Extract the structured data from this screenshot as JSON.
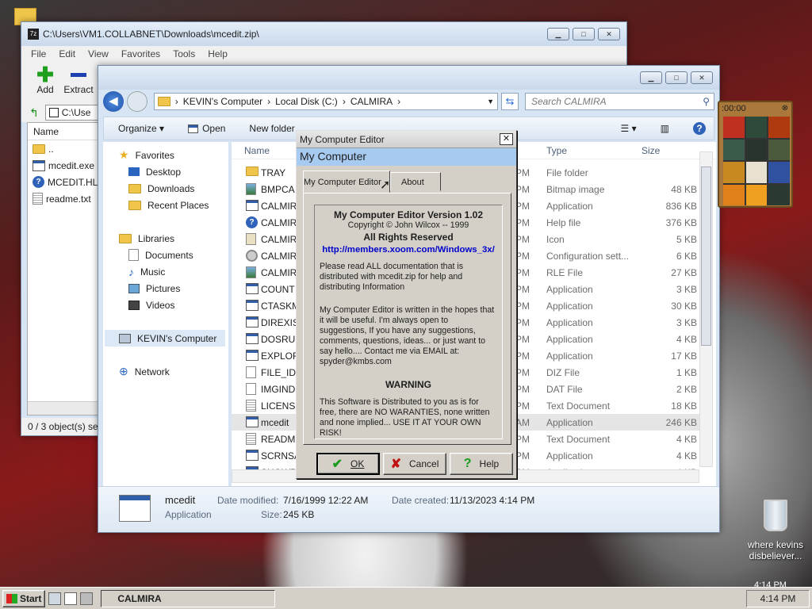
{
  "zip_window": {
    "title": "C:\\Users\\VM1.COLLABNET\\Downloads\\mcedit.zip\\",
    "menu": [
      "File",
      "Edit",
      "View",
      "Favorites",
      "Tools",
      "Help"
    ],
    "toolbar": {
      "add": "Add",
      "extract": "Extract"
    },
    "address": "C:\\Use",
    "col_name": "Name",
    "files": [
      {
        "name": "..",
        "icon": "folder-up"
      },
      {
        "name": "mcedit.exe",
        "icon": "app"
      },
      {
        "name": "MCEDIT.HLP",
        "icon": "help"
      },
      {
        "name": "readme.txt",
        "icon": "text"
      }
    ],
    "status": "0 / 3 object(s) se"
  },
  "explorer": {
    "breadcrumb": [
      "KEVIN's Computer",
      "Local Disk (C:)",
      "CALMIRA"
    ],
    "search_placeholder": "Search CALMIRA",
    "toolbar": {
      "organize": "Organize",
      "open": "Open",
      "new_folder": "New folder"
    },
    "nav": {
      "favorites": "Favorites",
      "fav_items": [
        "Desktop",
        "Downloads",
        "Recent Places"
      ],
      "libraries": "Libraries",
      "lib_items": [
        "Documents",
        "Music",
        "Pictures",
        "Videos"
      ],
      "computer": "KEVIN's Computer",
      "network": "Network"
    },
    "columns": {
      "name": "Name",
      "type": "Type",
      "size": "Size"
    },
    "files": [
      {
        "name": "TRAY",
        "date": "PM",
        "type": "File folder",
        "size": "",
        "icon": "folder"
      },
      {
        "name": "BMPCA",
        "date": "PM",
        "type": "Bitmap image",
        "size": "48 KB",
        "icon": "image"
      },
      {
        "name": "CALMIR",
        "date": "PM",
        "type": "Application",
        "size": "836 KB",
        "icon": "app"
      },
      {
        "name": "CALMIR",
        "date": "PM",
        "type": "Help file",
        "size": "376 KB",
        "icon": "help"
      },
      {
        "name": "CALMIR",
        "date": "PM",
        "type": "Icon",
        "size": "5 KB",
        "icon": "icon"
      },
      {
        "name": "CALMIR",
        "date": "PM",
        "type": "Configuration sett...",
        "size": "6 KB",
        "icon": "config"
      },
      {
        "name": "CALMIR",
        "date": "PM",
        "type": "RLE File",
        "size": "27 KB",
        "icon": "image"
      },
      {
        "name": "COUNT",
        "date": "PM",
        "type": "Application",
        "size": "3 KB",
        "icon": "app"
      },
      {
        "name": "CTASKM",
        "date": "PM",
        "type": "Application",
        "size": "30 KB",
        "icon": "app"
      },
      {
        "name": "DIREXIST",
        "date": "PM",
        "type": "Application",
        "size": "3 KB",
        "icon": "app"
      },
      {
        "name": "DOSRUN",
        "date": "PM",
        "type": "Application",
        "size": "4 KB",
        "icon": "app"
      },
      {
        "name": "EXPLORI",
        "date": "PM",
        "type": "Application",
        "size": "17 KB",
        "icon": "app"
      },
      {
        "name": "FILE_ID.D",
        "date": "PM",
        "type": "DIZ File",
        "size": "1 KB",
        "icon": "file"
      },
      {
        "name": "IMGINDI",
        "date": "PM",
        "type": "DAT File",
        "size": "2 KB",
        "icon": "file"
      },
      {
        "name": "LICENSE",
        "date": "PM",
        "type": "Text Document",
        "size": "18 KB",
        "icon": "text"
      },
      {
        "name": "mcedit",
        "date": "AM",
        "type": "Application",
        "size": "246 KB",
        "icon": "app",
        "selected": true
      },
      {
        "name": "README",
        "date": "PM",
        "type": "Text Document",
        "size": "4 KB",
        "icon": "text"
      },
      {
        "name": "SCRNSA",
        "date": "PM",
        "type": "Application",
        "size": "4 KB",
        "icon": "app"
      },
      {
        "name": "SHOWD",
        "date": "PM",
        "type": "Application",
        "size": "4 KB",
        "icon": "app"
      }
    ],
    "details": {
      "name": "mcedit",
      "type": "Application",
      "modified_label": "Date modified:",
      "modified": "7/16/1999 12:22 AM",
      "created_label": "Date created:",
      "created": "11/13/2023 4:14 PM",
      "size_label": "Size:",
      "size": "245 KB"
    }
  },
  "dialog": {
    "title": "My Computer Editor",
    "header": "My Computer",
    "tabs": [
      "My Computer Editor",
      "About"
    ],
    "version": "My Computer Editor Version 1.02",
    "copyright": "Copyright © John Wilcox -- 1999",
    "rights": "All Rights Reserved",
    "url": "http://members.xoom.com/Windows_3x/",
    "para1": "Please read ALL documentation that is distributed with mcedit.zip for help and distributing Information",
    "para2": "My Computer Editor is written in the hopes that it will be useful.  I'm always open to suggestions, If you have any suggestions, comments, questions, ideas... or just want to say hello.... Contact me via EMAIL at:  spyder@kmbs.com",
    "warning": "WARNING",
    "para3": "This Software is Distributed to you as is for free, there are NO WARANTIES,  none written and none implied...  USE IT AT YOUR OWN RISK!",
    "ok": "OK",
    "cancel": "Cancel",
    "help": "Help"
  },
  "widget": {
    "timer": ":00:00"
  },
  "recycle": {
    "label": "where kevins disbeliever..."
  },
  "taskbar": {
    "start": "Start",
    "task": "CALMIRA",
    "clock": "4:14 PM",
    "clock_top": "4:14 PM"
  }
}
